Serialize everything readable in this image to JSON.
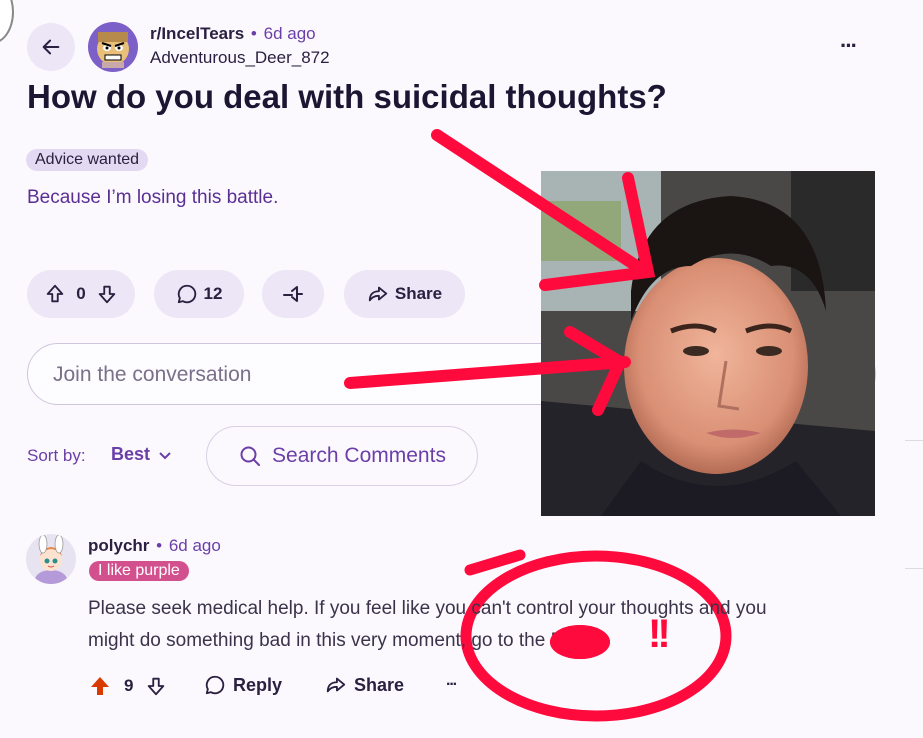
{
  "post": {
    "subreddit": "r/IncelTears",
    "separator": "•",
    "age": "6d ago",
    "author": "Adventurous_Deer_872",
    "title": "How do you deal with suicidal thoughts?",
    "flair": "Advice wanted",
    "body": "Because I’m losing this battle."
  },
  "actions": {
    "votes": "0",
    "comments": "12",
    "share": "Share"
  },
  "input": {
    "placeholder": "Join the conversation"
  },
  "sort": {
    "label": "Sort by:",
    "value": "Best",
    "search": "Search Comments"
  },
  "comment": {
    "author": "polychr",
    "separator": "•",
    "age": "6d ago",
    "flair": "I like purple",
    "text_line1": "Please seek medical help. If you feel like you can't control your thoughts and you",
    "text_line2": "might do something bad in this very moment, go to the ER.",
    "votes": "9",
    "reply": "Reply",
    "share": "Share",
    "more": "···"
  },
  "menu": {
    "more": "···"
  },
  "annotations": {
    "exclaim": "!!"
  },
  "colors": {
    "accent": "#6b3fa8",
    "upvote": "#d93a00",
    "annotation": "#ff0a3c",
    "pill": "#ece6f6",
    "flair": "#d3508f"
  },
  "icons": [
    "back-arrow-icon",
    "upvote-icon",
    "downvote-icon",
    "comment-icon",
    "award-icon",
    "share-icon",
    "search-icon",
    "chevron-down-icon",
    "reply-icon",
    "more-icon"
  ]
}
